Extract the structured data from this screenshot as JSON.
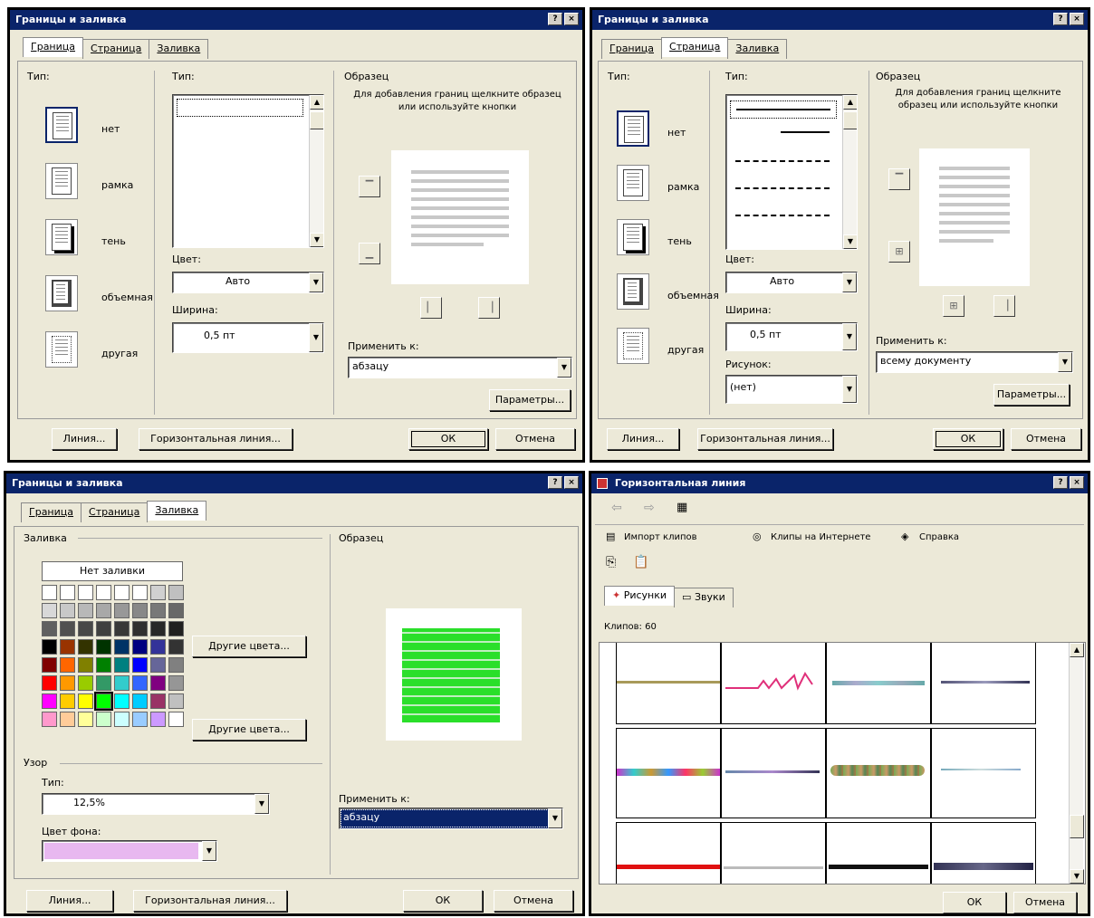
{
  "dlg1": {
    "title": "Границы и заливка",
    "tabs": [
      "Граница",
      "Страница",
      "Заливка"
    ],
    "type_label": "Тип:",
    "types": [
      "нет",
      "рамка",
      "тень",
      "объемная",
      "другая"
    ],
    "style_label": "Тип:",
    "color_label": "Цвет:",
    "color_value": "Авто",
    "width_label": "Ширина:",
    "width_value": "0,5 пт",
    "preview_label": "Образец",
    "preview_hint": "Для добавления границ щелкните образец или используйте кнопки",
    "apply_label": "Применить к:",
    "apply_value": "абзацу",
    "options_btn": "Параметры...",
    "bottom_buttons": [
      "Линия...",
      "Горизонтальная линия...",
      "ОК",
      "Отмена"
    ]
  },
  "dlg2": {
    "title": "Границы и заливка",
    "tabs": [
      "Граница",
      "Страница",
      "Заливка"
    ],
    "type_label": "Тип:",
    "types": [
      "нет",
      "рамка",
      "тень",
      "объемная",
      "другая"
    ],
    "style_label": "Тип:",
    "color_label": "Цвет:",
    "color_value": "Авто",
    "width_label": "Ширина:",
    "width_value": "0,5 пт",
    "art_label": "Рисунок:",
    "art_value": "(нет)",
    "preview_label": "Образец",
    "preview_hint": "Для добавления границ щелкните образец или используйте кнопки",
    "apply_label": "Применить к:",
    "apply_value": "всему документу",
    "options_btn": "Параметры...",
    "bottom_buttons": [
      "Линия...",
      "Горизонтальная линия...",
      "ОК",
      "Отмена"
    ]
  },
  "dlg3": {
    "title": "Границы и заливка",
    "tabs": [
      "Граница",
      "Страница",
      "Заливка"
    ],
    "fill_label": "Заливка",
    "no_color": "Нет заливки",
    "more_colors_btn": "Другие цвета...",
    "more_colors2_btn": "Другие цвета...",
    "pattern_label": "Узор",
    "pattern_type_label": "Тип:",
    "pattern_type_value": "12,5%",
    "pattern_color_label": "Цвет фона:",
    "preview_label": "Образец",
    "apply_label": "Применить к:",
    "apply_value": "абзацу",
    "bottom_buttons": [
      "Линия...",
      "Горизонтальная линия...",
      "ОК",
      "Отмена"
    ],
    "palette": [
      [
        "#ffffff",
        "#ffffff",
        "#ffffff",
        "#ffffff",
        "#ffffff",
        "#ffffff",
        "#d0d0d0",
        "#c0c0c0"
      ],
      [
        "#d8d8d8",
        "#c8c8c8",
        "#b8b8b8",
        "#a8a8a8",
        "#989898",
        "#888888",
        "#787878",
        "#686868"
      ],
      [
        "#606060",
        "#505050",
        "#484848",
        "#404040",
        "#383838",
        "#303030",
        "#282828",
        "#202020"
      ],
      [
        "#000000",
        "#993300",
        "#333300",
        "#003300",
        "#003366",
        "#000080",
        "#333399",
        "#333333"
      ],
      [
        "#800000",
        "#ff6600",
        "#808000",
        "#008000",
        "#008080",
        "#0000ff",
        "#666699",
        "#808080"
      ],
      [
        "#ff0000",
        "#ff9900",
        "#99cc00",
        "#339966",
        "#33cccc",
        "#3366ff",
        "#800080",
        "#969696"
      ],
      [
        "#ff00ff",
        "#ffcc00",
        "#ffff00",
        "#00ff00",
        "#00ffff",
        "#00ccff",
        "#993366",
        "#c0c0c0"
      ],
      [
        "#ff99cc",
        "#ffcc99",
        "#ffff99",
        "#ccffcc",
        "#ccffff",
        "#99ccff",
        "#cc99ff",
        "#ffffff"
      ]
    ],
    "bg_color": "#e8b8f0",
    "preview_color": "#2adf2a"
  },
  "dlg4": {
    "title": "Горизонтальная линия",
    "toolbar": [
      "Импорт клипов",
      "Клипы на Интернете",
      "Справка"
    ],
    "tabs": [
      "Рисунки",
      "Звуки"
    ],
    "category_label": "Клипов: 60",
    "buttons": [
      "ОК",
      "Отмена"
    ]
  },
  "colors": {
    "title_bg": "#0a246a",
    "dialog_bg": "#ece9d8",
    "selection": "#0a246a"
  }
}
